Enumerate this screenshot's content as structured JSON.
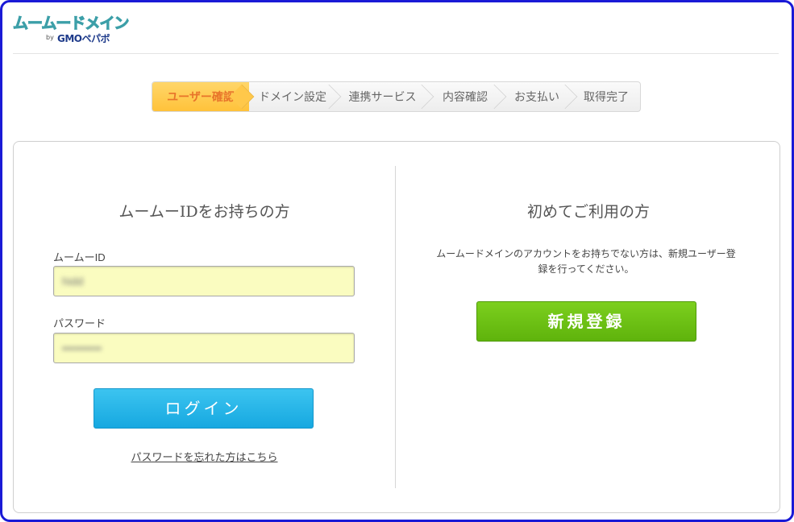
{
  "logo": {
    "name": "ムームードメイン",
    "by": "by",
    "company": "GMOペパボ"
  },
  "steps": [
    {
      "label": "ユーザー確認",
      "active": true
    },
    {
      "label": "ドメイン設定",
      "active": false
    },
    {
      "label": "連携サービス",
      "active": false
    },
    {
      "label": "内容確認",
      "active": false
    },
    {
      "label": "お支払い",
      "active": false
    },
    {
      "label": "取得完了",
      "active": false
    }
  ],
  "login": {
    "title": "ムームーIDをお持ちの方",
    "id_label": "ムームーID",
    "id_value": "hidd",
    "password_label": "パスワード",
    "password_value": "••••••••••",
    "button": "ログイン",
    "forgot_link": "パスワードを忘れた方はこちら"
  },
  "register": {
    "title": "初めてご利用の方",
    "description": "ムームードメインのアカウントをお持ちでない方は、新規ユーザー登録を行ってください。",
    "button": "新規登録"
  },
  "colors": {
    "frame": "#1a1ad6",
    "active_step": "#ffc23a",
    "login_button": "#16a8e0",
    "register_button": "#5fb30c",
    "input_bg": "#fafcc0"
  }
}
